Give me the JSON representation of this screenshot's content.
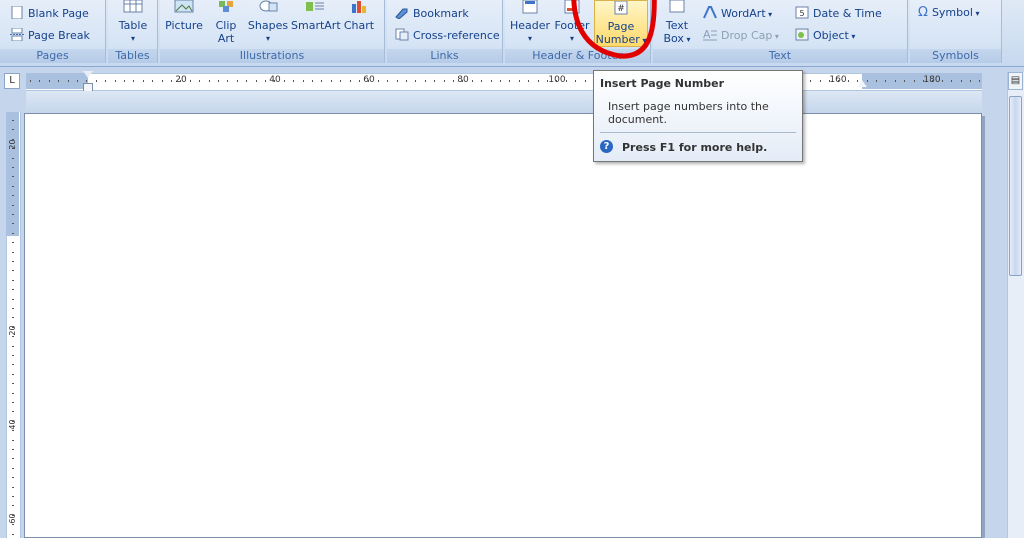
{
  "ribbon": {
    "pages": {
      "group_label": "Pages",
      "blank_page": "Blank Page",
      "page_break": "Page Break"
    },
    "tables": {
      "group_label": "Tables",
      "table": "Table"
    },
    "illustrations": {
      "group_label": "Illustrations",
      "picture": "Picture",
      "clip_art_1": "Clip",
      "clip_art_2": "Art",
      "shapes": "Shapes",
      "smartart": "SmartArt",
      "chart": "Chart"
    },
    "links": {
      "group_label": "Links",
      "bookmark": "Bookmark",
      "cross_reference": "Cross-reference"
    },
    "header_footer": {
      "group_label": "Header & Footer",
      "header": "Header",
      "footer": "Footer",
      "page_number_1": "Page",
      "page_number_2": "Number"
    },
    "text": {
      "group_label": "Text",
      "text_box_1": "Text",
      "text_box_2": "Box",
      "wordart": "WordArt",
      "drop_cap": "Drop Cap",
      "date_time": "Date & Time",
      "object": "Object"
    },
    "symbols": {
      "group_label": "Symbols",
      "symbol": "Symbol"
    }
  },
  "ruler": {
    "tab_selector": "L",
    "h_labels": [
      "20",
      "40",
      "60",
      "80",
      "100",
      "160",
      "180"
    ],
    "v_labels": [
      "20",
      "20",
      "40",
      "60"
    ]
  },
  "tooltip": {
    "title": "Insert Page Number",
    "description": "Insert page numbers into the document.",
    "help": "Press F1 for more help."
  },
  "colors": {
    "ribbon_text": "#15428b",
    "highlight": "#ffd96b",
    "annotation_red": "#e00000"
  }
}
